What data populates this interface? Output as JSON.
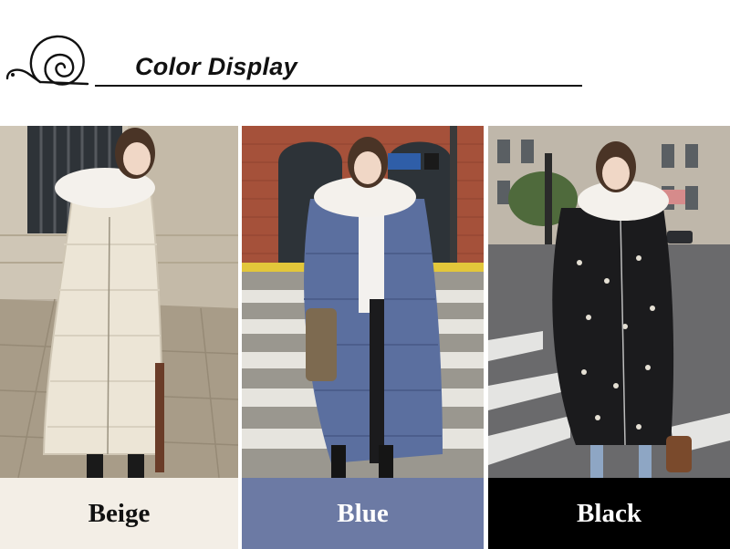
{
  "header": {
    "title": "Color Display",
    "icon": "snail-icon"
  },
  "variants": [
    {
      "label": "Beige",
      "swatch_color": "#f3eee6",
      "label_color": "#111111",
      "coat_color": "#ece5d6",
      "scene": "stone-building-sidewalk"
    },
    {
      "label": "Blue",
      "swatch_color": "#6c7aa4",
      "label_color": "#ffffff",
      "coat_color": "#5b6f9f",
      "scene": "brick-building-crosswalk"
    },
    {
      "label": "Black",
      "swatch_color": "#000000",
      "label_color": "#ffffff",
      "coat_color": "#1b1b1d",
      "scene": "city-street-crosswalk"
    }
  ]
}
